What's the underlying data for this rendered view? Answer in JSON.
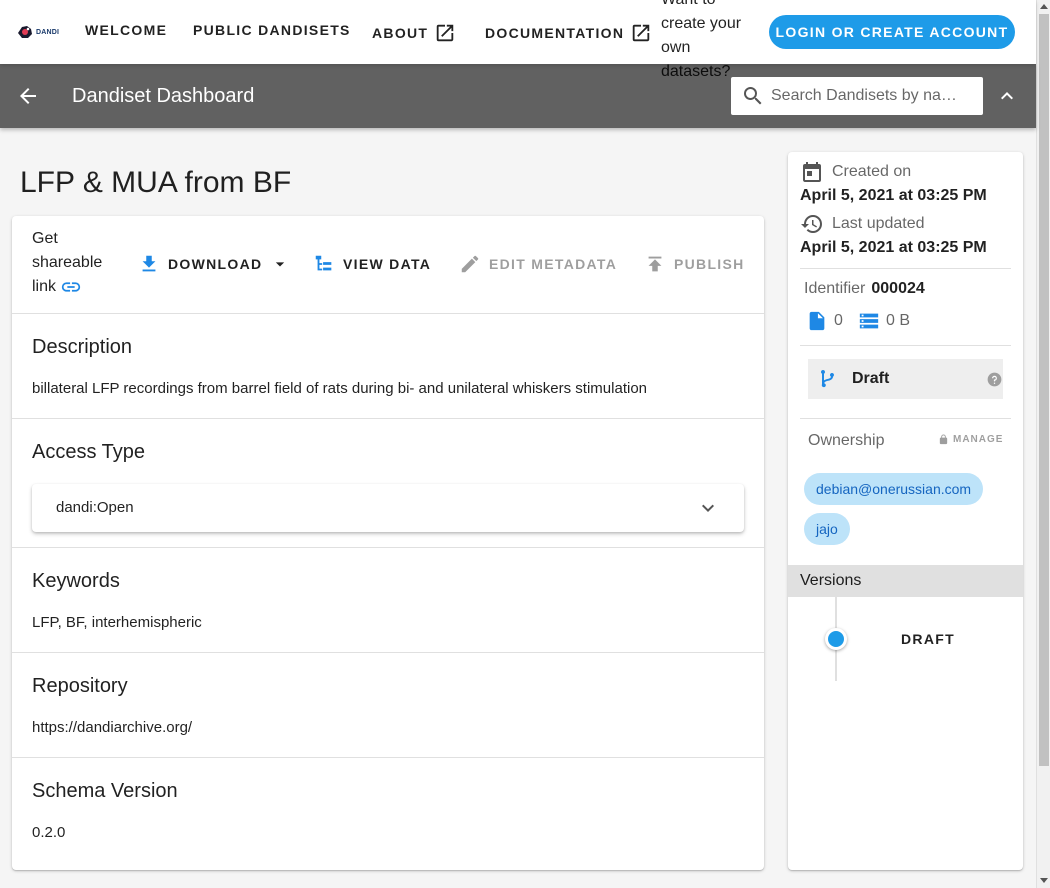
{
  "topnav": {
    "logo_text": "DANDI",
    "links": [
      {
        "label": "WELCOME"
      },
      {
        "label": "PUBLIC DANDISETS"
      },
      {
        "label": "ABOUT"
      },
      {
        "label": "DOCUMENTATION"
      }
    ],
    "prompt_text": "Want to create your own datasets?",
    "login_label": "LOGIN OR CREATE ACCOUNT"
  },
  "dashbar": {
    "title": "Dandiset Dashboard",
    "search_placeholder": "Search Dandisets by na…"
  },
  "dandiset": {
    "title": "LFP & MUA from BF",
    "toolbar": {
      "share_label": "Get shareable link",
      "download_label": "DOWNLOAD",
      "view_data_label": "VIEW DATA",
      "edit_metadata_label": "EDIT METADATA",
      "publish_label": "PUBLISH"
    },
    "sections": {
      "description": {
        "heading": "Description",
        "value": "billateral LFP recordings from barrel field of rats during bi- and unilateral whiskers stimulation"
      },
      "access_type": {
        "heading": "Access Type",
        "value": "dandi:Open"
      },
      "keywords": {
        "heading": "Keywords",
        "value": "LFP, BF, interhemispheric"
      },
      "repository": {
        "heading": "Repository",
        "value": "https://dandiarchive.org/"
      },
      "schema_version": {
        "heading": "Schema Version",
        "value": "0.2.0"
      }
    }
  },
  "sidebar": {
    "created_label": "Created on",
    "created_date": "April 5, 2021 at 03:25 PM",
    "updated_label": "Last updated",
    "updated_date": "April 5, 2021 at 03:25 PM",
    "identifier_label": "Identifier",
    "identifier_value": "000024",
    "file_count": "0",
    "size": "0 B",
    "version_status": "Draft",
    "ownership_label": "Ownership",
    "manage_label": "MANAGE",
    "owners": [
      "debian@onerussian.com",
      "jajo"
    ],
    "versions_label": "Versions",
    "versions": [
      {
        "label": "DRAFT"
      }
    ]
  },
  "colors": {
    "accent": "#1e9be8",
    "dashbar": "#616161",
    "chip_bg": "#bde3f9"
  }
}
